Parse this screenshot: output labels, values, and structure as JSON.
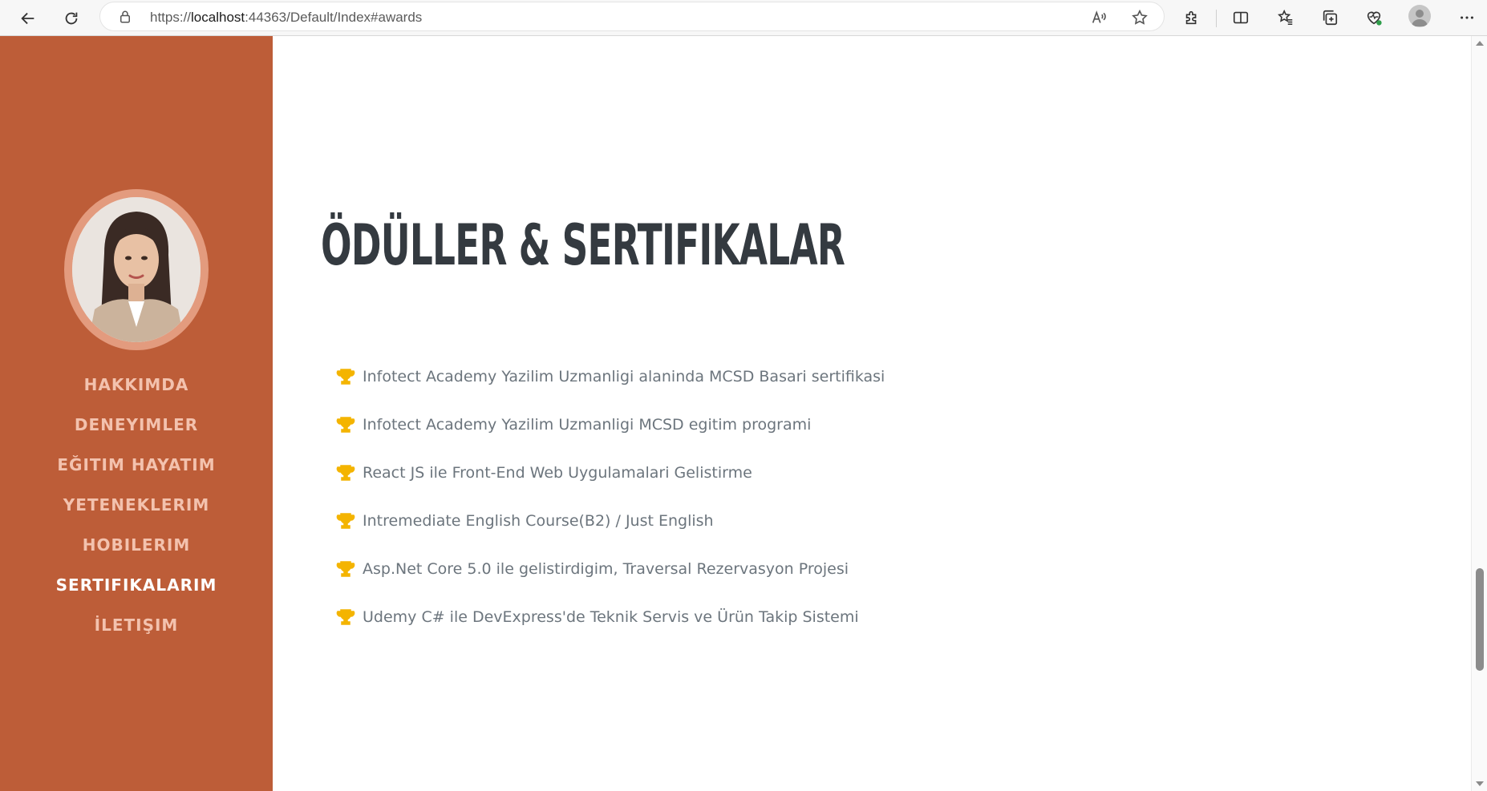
{
  "browser": {
    "url_prefix": "https://",
    "url_host": "localhost",
    "url_rest": ":44363/Default/Index#awards"
  },
  "sidebar": {
    "accent_color": "#bd5d38",
    "items": [
      {
        "label": "HAKKIMDA",
        "active": false
      },
      {
        "label": "DENEYIMLER",
        "active": false
      },
      {
        "label": "EĞITIM HAYATIM",
        "active": false
      },
      {
        "label": "YETENEKLERIM",
        "active": false
      },
      {
        "label": "HOBILERIM",
        "active": false
      },
      {
        "label": "SERTIFIKALARIM",
        "active": true
      },
      {
        "label": "İLETIŞIM",
        "active": false
      }
    ]
  },
  "main": {
    "heading": "ÖDÜLLER & SERTIFIKALAR",
    "trophy_color": "#f4b400",
    "awards": [
      "Infotect Academy Yazilim Uzmanligi alaninda MCSD Basari sertifikasi",
      "Infotect Academy Yazilim Uzmanligi MCSD egitim programi",
      "React JS ile Front-End Web Uygulamalari Gelistirme",
      "Intremediate English Course(B2) / Just English",
      "Asp.Net Core 5.0 ile gelistirdigim, Traversal Rezervasyon Projesi",
      "Udemy C# ile DevExpress'de Teknik Servis ve Ürün Takip Sistemi"
    ]
  }
}
